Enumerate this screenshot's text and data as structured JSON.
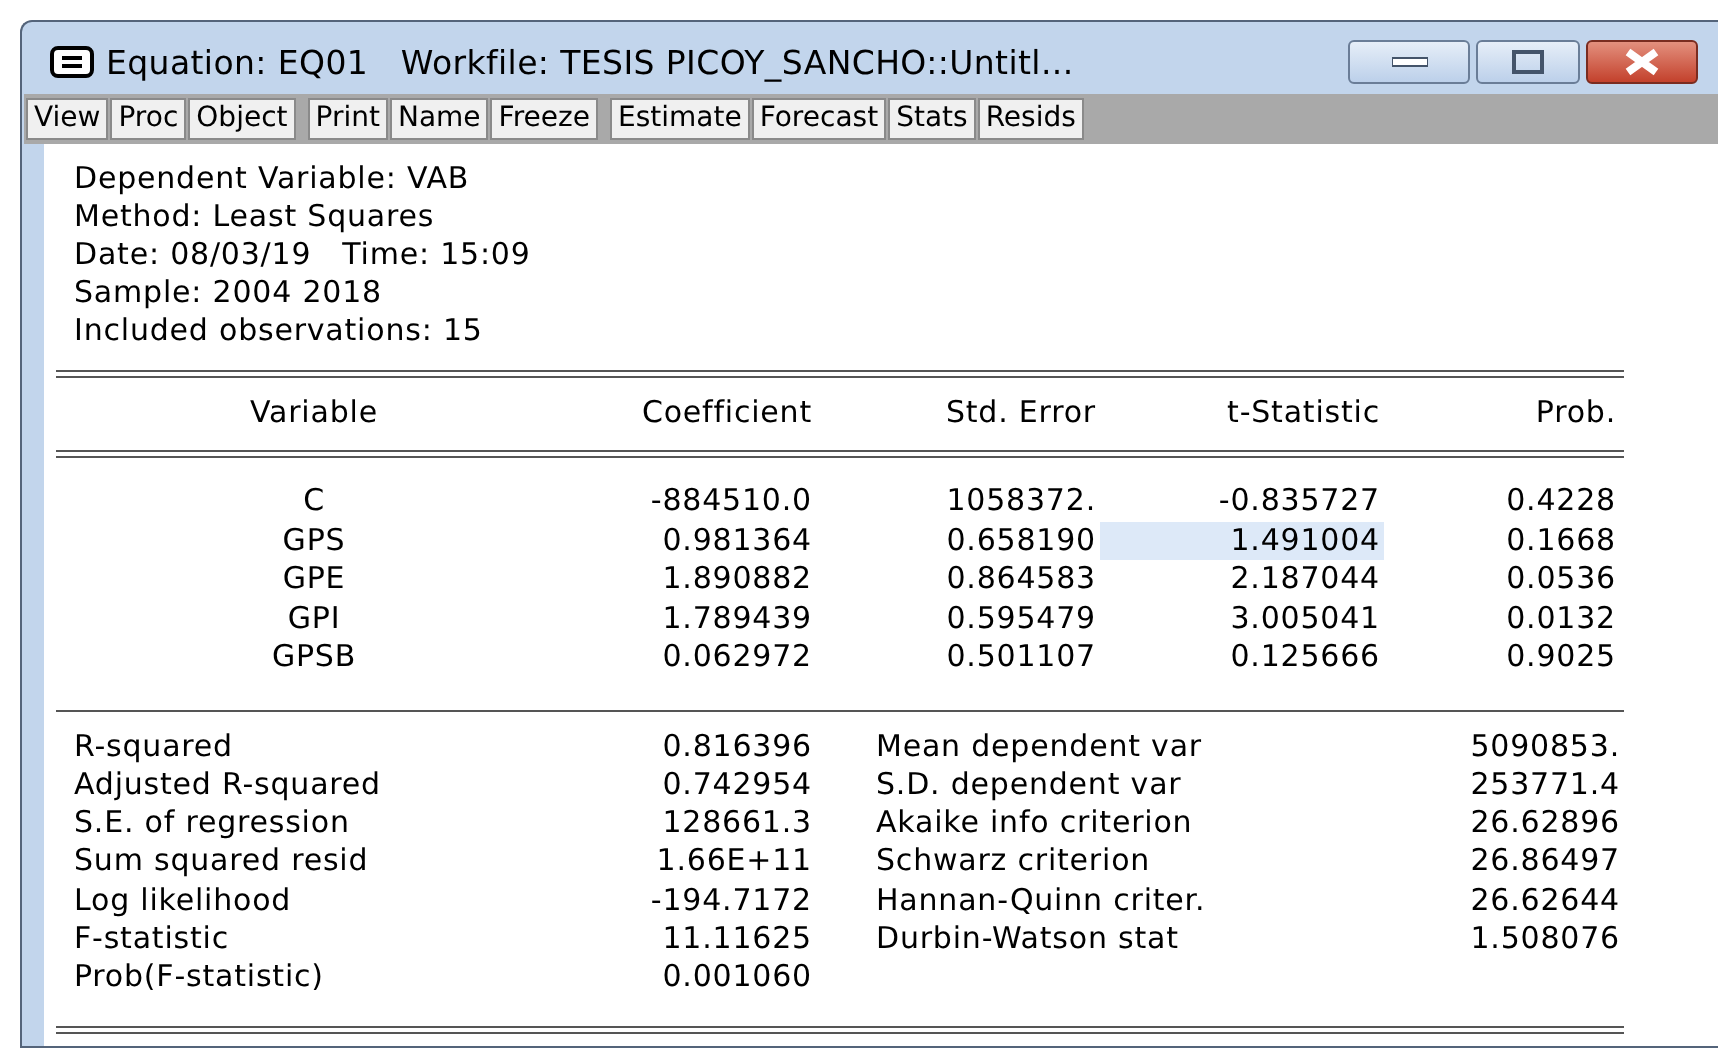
{
  "window": {
    "title": "Equation: EQ01   Workfile: TESIS PICOY_SANCHO::Untitl...",
    "controls": [
      {
        "kind": "minimize"
      },
      {
        "kind": "maximize"
      },
      {
        "kind": "close"
      }
    ]
  },
  "toolbar": [
    [
      "View",
      "Proc",
      "Object"
    ],
    [
      "Print",
      "Name",
      "Freeze"
    ],
    [
      "Estimate",
      "Forecast",
      "Stats",
      "Resids"
    ]
  ],
  "header": [
    "Dependent Variable: VAB",
    "Method: Least Squares",
    "Date: 08/03/19   Time: 15:09",
    "Sample: 2004 2018",
    "Included observations: 15"
  ],
  "table": {
    "columns": [
      "Variable",
      "Coefficient",
      "Std. Error",
      "t-Statistic",
      "Prob."
    ],
    "rows": [
      [
        {
          "text": "C",
          "selected": false
        },
        {
          "text": "-884510.0",
          "selected": false
        },
        {
          "text": "1058372.",
          "selected": false
        },
        {
          "text": "-0.835727",
          "selected": false
        },
        {
          "text": "0.4228",
          "selected": false
        }
      ],
      [
        {
          "text": "GPS",
          "selected": false
        },
        {
          "text": "0.981364",
          "selected": false
        },
        {
          "text": "0.658190",
          "selected": false
        },
        {
          "text": "1.491004",
          "selected": true
        },
        {
          "text": "0.1668",
          "selected": false
        }
      ],
      [
        {
          "text": "GPE",
          "selected": false
        },
        {
          "text": "1.890882",
          "selected": false
        },
        {
          "text": "0.864583",
          "selected": false
        },
        {
          "text": "2.187044",
          "selected": false
        },
        {
          "text": "0.0536",
          "selected": false
        }
      ],
      [
        {
          "text": "GPI",
          "selected": false
        },
        {
          "text": "1.789439",
          "selected": false
        },
        {
          "text": "0.595479",
          "selected": false
        },
        {
          "text": "3.005041",
          "selected": false
        },
        {
          "text": "0.0132",
          "selected": false
        }
      ],
      [
        {
          "text": "GPSB",
          "selected": false
        },
        {
          "text": "0.062972",
          "selected": false
        },
        {
          "text": "0.501107",
          "selected": false
        },
        {
          "text": "0.125666",
          "selected": false
        },
        {
          "text": "0.9025",
          "selected": false
        }
      ]
    ]
  },
  "statistics": [
    {
      "label": "R-squared",
      "value": "0.816396",
      "label_2": "Mean dependent var",
      "value_2": "5090853."
    },
    {
      "label": "Adjusted R-squared",
      "value": "0.742954",
      "label_2": "S.D. dependent var",
      "value_2": "253771.4"
    },
    {
      "label": "S.E. of regression",
      "value": "128661.3",
      "label_2": "Akaike info criterion",
      "value_2": "26.62896"
    },
    {
      "label": "Sum squared resid",
      "value": "1.66E+11",
      "label_2": "Schwarz criterion",
      "value_2": "26.86497"
    },
    {
      "label": "Log likelihood",
      "value": "-194.7172",
      "label_2": "Hannan-Quinn criter.",
      "value_2": "26.62644"
    },
    {
      "label": "F-statistic",
      "value": "11.11625",
      "label_2": "Durbin-Watson stat",
      "value_2": "1.508076"
    },
    {
      "label": "Prob(F-statistic)",
      "value": "0.001060"
    }
  ]
}
